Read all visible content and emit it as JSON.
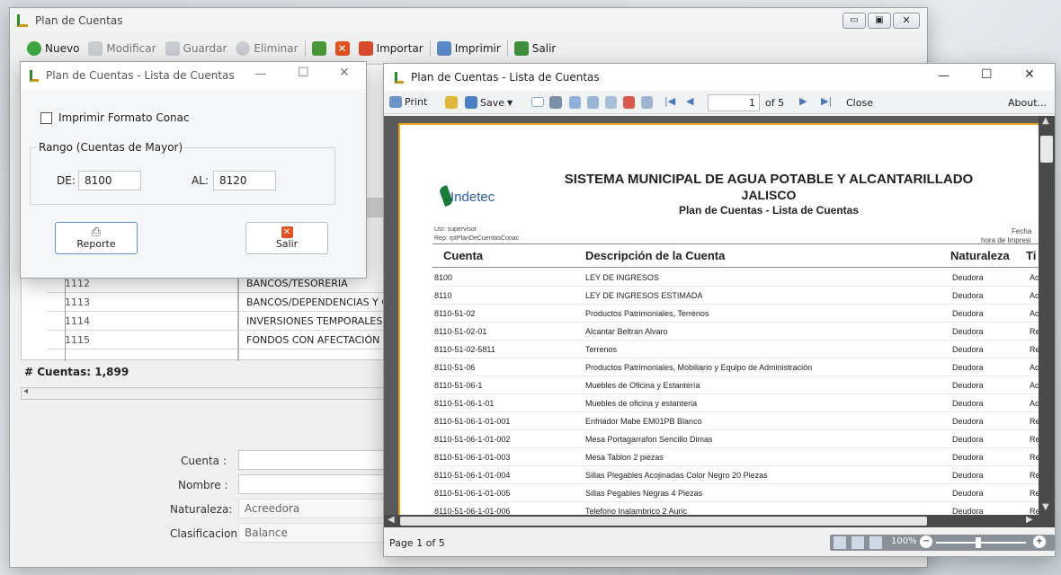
{
  "main": {
    "title": "Plan de Cuentas",
    "toolbar": {
      "nuevo": "Nuevo",
      "modificar": "Modificar",
      "guardar": "Guardar",
      "eliminar": "Eliminar",
      "importar": "Importar",
      "imprimir": "Imprimir",
      "salir": "Salir"
    },
    "grid": {
      "rows": [
        {
          "code": "1112",
          "desc": "BANCOS/TESORERIA"
        },
        {
          "code": "1113",
          "desc": "BANCOS/DEPENDENCIAS Y OTROS"
        },
        {
          "code": "1114",
          "desc": "INVERSIONES TEMPORALES (HAST"
        },
        {
          "code": "1115",
          "desc": "FONDOS CON AFECTACIÓN ESPEC"
        }
      ],
      "count": "# Cuentas: 1,899"
    },
    "form": {
      "cuenta_label": "Cuenta :",
      "cuenta_value": "",
      "nombre_label": "Nombre :",
      "nombre_value": "",
      "naturaleza_label": "Naturaleza:",
      "naturaleza_value": "Acreedora",
      "clasificacion_label": "Clasificacion:",
      "clasificacion_value": "Balance"
    }
  },
  "dialog": {
    "title": "Plan de Cuentas - Lista de Cuentas",
    "checkbox_label": "Imprimir Formato Conac",
    "group_label": "Rango (Cuentas de Mayor)",
    "de_label": "DE:",
    "de_value": "8100",
    "al_label": "AL:",
    "al_value": "8120",
    "reporte": "Reporte",
    "salir": "Salir"
  },
  "viewer": {
    "title": "Plan de Cuentas - Lista de Cuentas",
    "toolbar": {
      "print": "Print",
      "save": "Save",
      "page_input": "1",
      "page_of": "of 5",
      "close": "Close",
      "about": "About..."
    },
    "status": {
      "page": "Page 1 of 5",
      "zoom": "100%"
    },
    "report": {
      "logo": "Indetec",
      "title1": "SISTEMA MUNICIPAL DE AGUA POTABLE Y ALCANTARILLADO",
      "title2": "JALISCO",
      "subtitle": "Plan de Cuentas - Lista de Cuentas",
      "usr": "Usr: supervisor",
      "rep": "Rep: rptPlanDeCuentasConac",
      "fecha": "Fecha",
      "hora": "hora de Impresi",
      "headers": {
        "cuenta": "Cuenta",
        "desc": "Descripción de la Cuenta",
        "nat": "Naturaleza",
        "tipo": "Ti"
      },
      "rows": [
        {
          "c": "8100",
          "d": "LEY DE INGRESOS",
          "n": "Deudora",
          "t": "Ac"
        },
        {
          "c": "8110",
          "d": "LEY DE INGRESOS ESTIMADA",
          "n": "Deudora",
          "t": "Ac"
        },
        {
          "c": "8110-51-02",
          "d": "Productos Patrimoniales, Terrenos",
          "n": "Deudora",
          "t": "Ac"
        },
        {
          "c": "8110-51-02-01",
          "d": "Alcantar Beltran Alvaro",
          "n": "Deudora",
          "t": "Re"
        },
        {
          "c": "8110-51-02-5811",
          "d": "Terrenos",
          "n": "Deudora",
          "t": "Re"
        },
        {
          "c": "8110-51-06",
          "d": "Productos Patrimoniales, Mobiliario y Equipo de Administración",
          "n": "Deudora",
          "t": "Ac"
        },
        {
          "c": "8110-51-06-1",
          "d": "Muebles de Oficina y Estantería",
          "n": "Deudora",
          "t": "Ac"
        },
        {
          "c": "8110-51-06-1-01",
          "d": "Muebles de oficina y estanteria",
          "n": "Deudora",
          "t": "Ac"
        },
        {
          "c": "8110-51-06-1-01-001",
          "d": "Enfriador Mabe EM01PB Blanco",
          "n": "Deudora",
          "t": "Re"
        },
        {
          "c": "8110-51-06-1-01-002",
          "d": "Mesa Portagarrafon Sencillo Dimas",
          "n": "Deudora",
          "t": "Re"
        },
        {
          "c": "8110-51-06-1-01-003",
          "d": "Mesa Tablon 2 piezas",
          "n": "Deudora",
          "t": "Re"
        },
        {
          "c": "8110-51-06-1-01-004",
          "d": "Sillas Plegables Acojinadas Color Negro 20 Piezas",
          "n": "Deudora",
          "t": "Re"
        },
        {
          "c": "8110-51-06-1-01-005",
          "d": "Sillas Pegables Negras 4 Piezas",
          "n": "Deudora",
          "t": "Re"
        },
        {
          "c": "8110-51-06-1-01-006",
          "d": "Telefono Inalambrico 2 Auric",
          "n": "Deudora",
          "t": "Re"
        }
      ]
    }
  }
}
